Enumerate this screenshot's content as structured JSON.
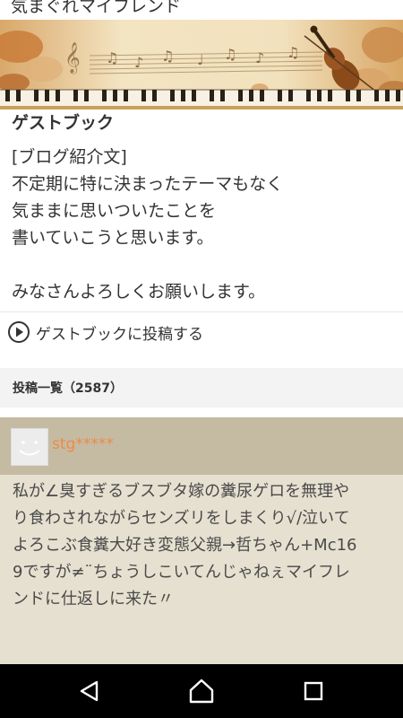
{
  "blog": {
    "title": "気まぐれマイフレンド"
  },
  "guestbook": {
    "heading": "ゲストブック",
    "intro_lines": [
      "[ブログ紹介文]",
      "不定期に特に決まったテーマもなく",
      "気ままに思いついたことを",
      "書いていこうと思います。",
      "",
      "みなさんよろしくお願いします。"
    ],
    "post_link_label": "ゲストブックに投稿する"
  },
  "post_list": {
    "header": "投稿一覧（2587）",
    "entries": [
      {
        "author": "stg*****",
        "body_lines": [
          "私が∠臭すぎるブスブタ嫁の糞尿ゲロを無理や",
          "り食わされながらセンズリをしまくり√/泣いて",
          "よろこぶ食糞大好き変態父親→哲ちゃん+Mc16",
          "9ですが≠¨ちょうしこいてんじゃねぇマイフレ",
          "ンドに仕返しに来た〃"
        ]
      }
    ]
  },
  "icons": {
    "post_link": "play-circle-icon",
    "nav_back": "back-triangle-icon",
    "nav_home": "home-icon",
    "nav_recents": "recents-square-icon",
    "avatar": "avatar-face-icon"
  },
  "colors": {
    "author": "#f08a45",
    "entry_bg": "#e6e0d0",
    "entry_head_bg": "#c5bba3",
    "list_header_bg": "#f3f3f3",
    "navbar_bg": "#000000"
  }
}
